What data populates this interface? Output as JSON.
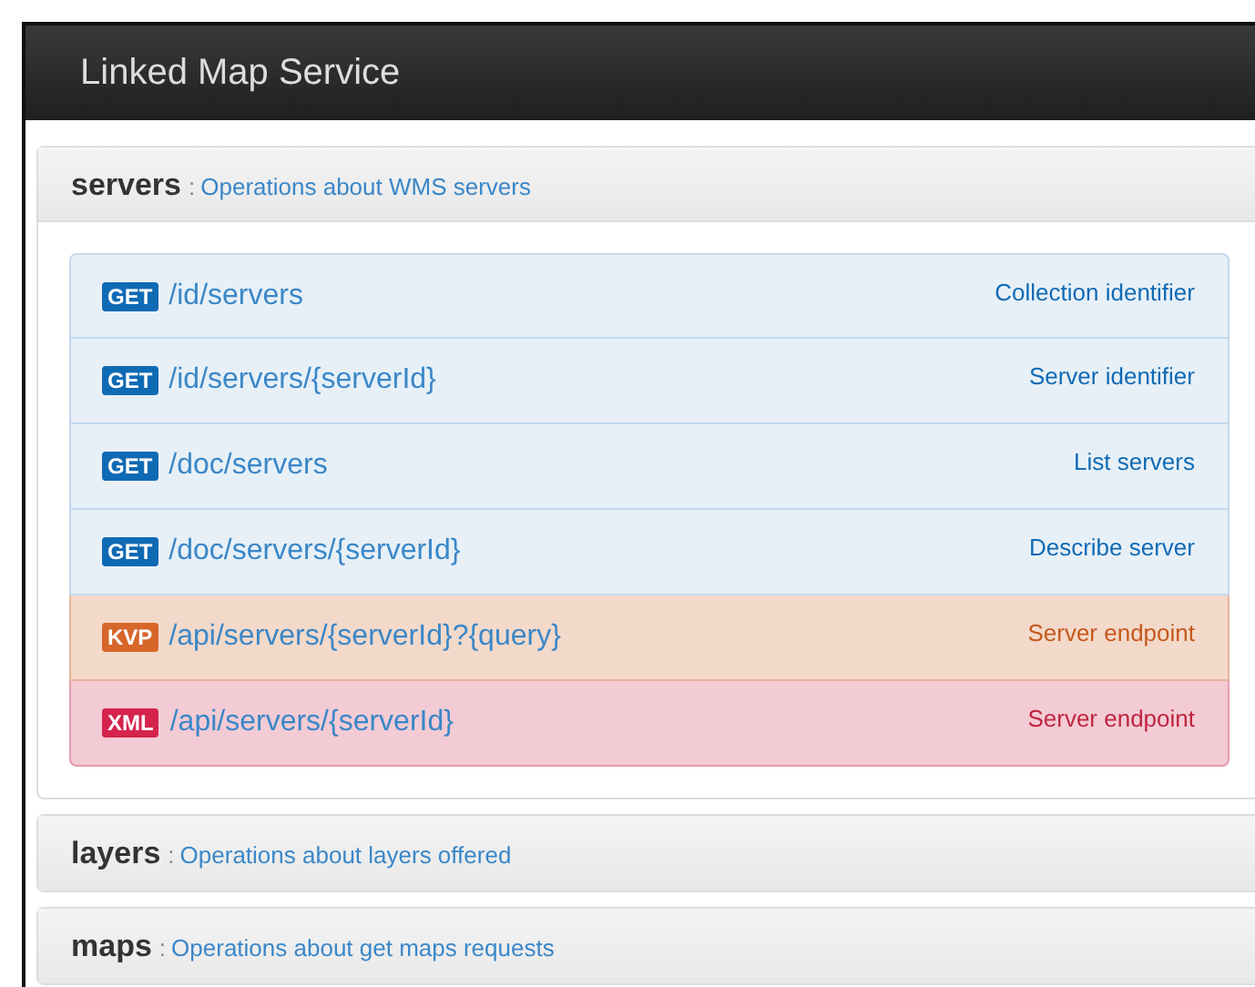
{
  "window": {
    "title": "Linked Map Service"
  },
  "sections": [
    {
      "name": "servers",
      "separator": ":",
      "description": "Operations about WMS servers",
      "expanded": true,
      "operations": [
        {
          "kind": "get",
          "method": "GET",
          "path": "/id/servers",
          "summary": "Collection identifier"
        },
        {
          "kind": "get",
          "method": "GET",
          "path": "/id/servers/{serverId}",
          "summary": "Server identifier"
        },
        {
          "kind": "get",
          "method": "GET",
          "path": "/doc/servers",
          "summary": "List servers"
        },
        {
          "kind": "get",
          "method": "GET",
          "path": "/doc/servers/{serverId}",
          "summary": "Describe server"
        },
        {
          "kind": "kvp",
          "method": "KVP",
          "path": "/api/servers/{serverId}?{query}",
          "summary": "Server endpoint"
        },
        {
          "kind": "xml",
          "method": "XML",
          "path": "/api/servers/{serverId}",
          "summary": "Server endpoint"
        }
      ]
    },
    {
      "name": "layers",
      "separator": ":",
      "description": "Operations about layers offered",
      "expanded": false
    },
    {
      "name": "maps",
      "separator": ":",
      "description": "Operations about get maps requests",
      "expanded": false
    }
  ]
}
